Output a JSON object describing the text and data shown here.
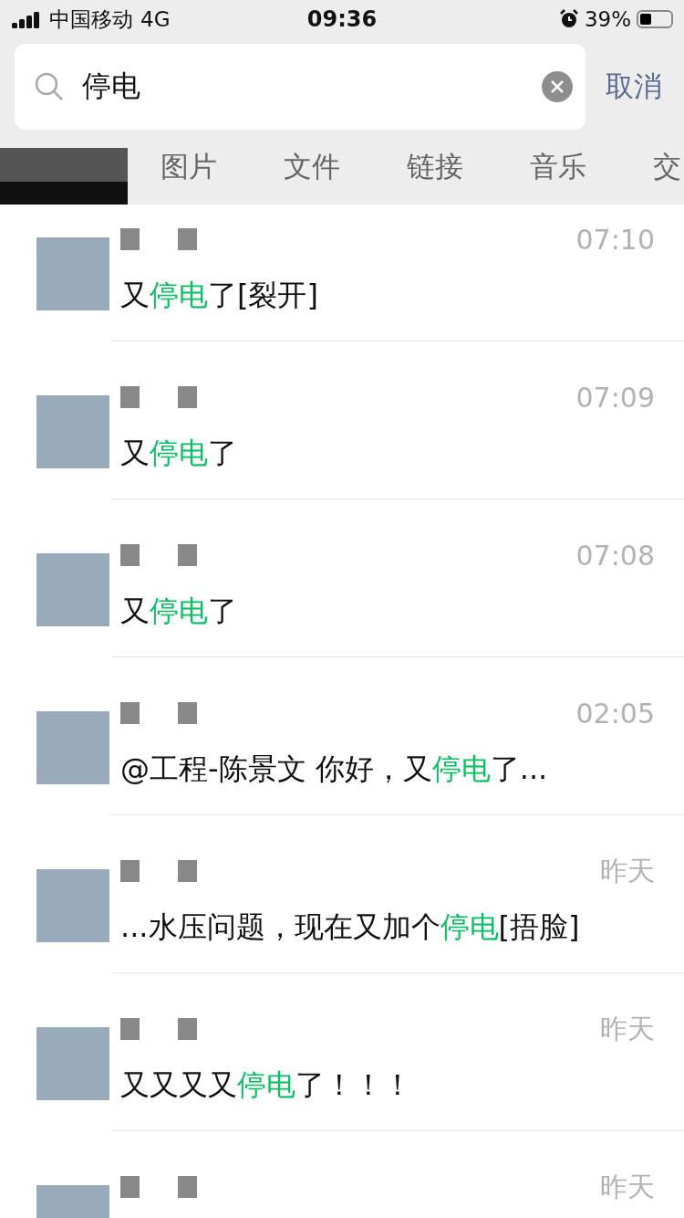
{
  "status_bar": {
    "carrier": "中国移动",
    "network": "4G",
    "time": "09:36",
    "battery": "39%"
  },
  "search": {
    "value": "停电",
    "cancel": "取消"
  },
  "tabs": [
    {
      "label": "图片",
      "selected": false
    },
    {
      "label": "文件",
      "selected": false
    },
    {
      "label": "链接",
      "selected": false
    },
    {
      "label": "音乐",
      "selected": false
    },
    {
      "label": "交",
      "selected": false
    }
  ],
  "results": [
    {
      "time": "07:10",
      "message": {
        "before": "又",
        "match": "停电",
        "after": "了[裂开]"
      }
    },
    {
      "time": "07:09",
      "message": {
        "before": "又",
        "match": "停电",
        "after": "了"
      }
    },
    {
      "time": "07:08",
      "message": {
        "before": "又",
        "match": "停电",
        "after": "了"
      }
    },
    {
      "time": "02:05",
      "message": {
        "before": "@工程-陈景文 你好，又",
        "match": "停电",
        "after": "了..."
      }
    },
    {
      "time": "昨天",
      "message": {
        "before": "...水压问题，现在又加个",
        "match": "停电",
        "after": "[捂脸]"
      }
    },
    {
      "time": "昨天",
      "message": {
        "before": "又又又又",
        "match": "停电",
        "after": "了！！！"
      }
    },
    {
      "time": "昨天"
    }
  ]
}
